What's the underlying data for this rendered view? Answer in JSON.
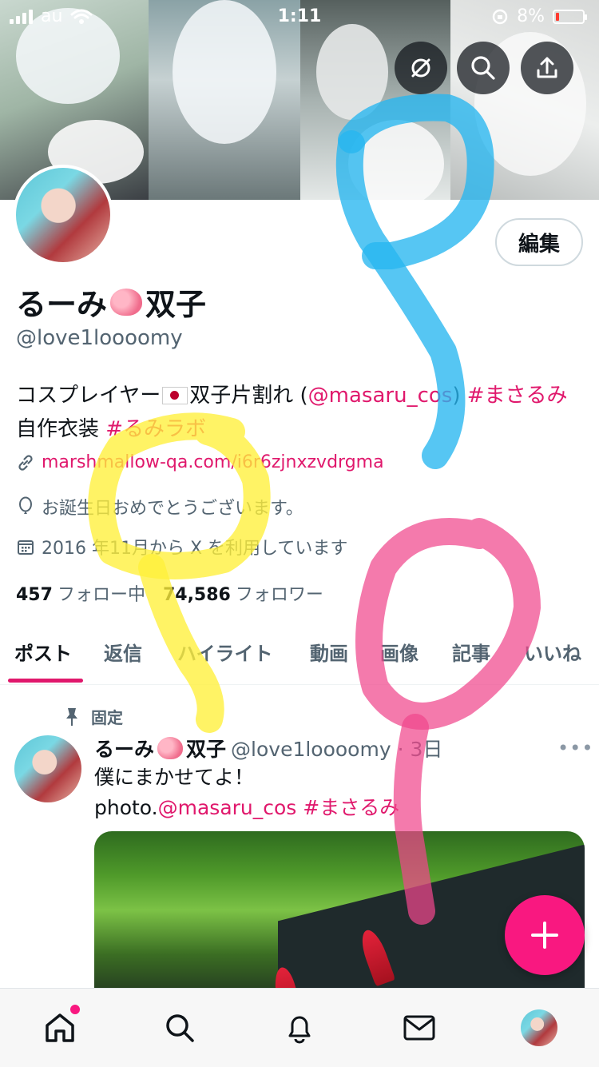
{
  "status_bar": {
    "carrier": "au",
    "time": "1:11",
    "battery": "8%"
  },
  "profile": {
    "edit_label": "編集",
    "name": "るーみ",
    "name_suffix": "双子",
    "handle": "@love1loooomy",
    "bio_line1_a": "コスプレイヤー",
    "bio_line1_b": "双子片割れ (",
    "bio_mention": "@masaru_cos",
    "bio_line1_c": ") ",
    "bio_hashtag1": "#まさるみ",
    "bio_line2_a": "自作衣装 ",
    "bio_hashtag2": "#るみラボ",
    "link": "marshmallow-qa.com/i6r6zjnxzvdrgma",
    "birthday": "お誕生日おめでとうございます。",
    "joined": "2016 年11月から X を利用しています",
    "following_count": "457",
    "following_label": "フォロー中",
    "followers_count": "74,586",
    "followers_label": "フォロワー"
  },
  "tabs": [
    "ポスト",
    "返信",
    "ハイライト",
    "動画",
    "画像",
    "記事",
    "いいね"
  ],
  "post": {
    "pinned_label": "固定",
    "author": "るーみ",
    "author_suffix": "双子",
    "handle_time": "@love1loooomy · 3日",
    "more": "•••",
    "line1": "僕にまかせてよ！",
    "line2_a": "photo.",
    "mention": "@masaru_cos",
    "hashtag": " #まさるみ"
  },
  "colors": {
    "accent": "#f91880",
    "link": "#e0186c",
    "muted": "#536471"
  },
  "icons": [
    "signal-icon",
    "wifi-icon",
    "lock-rotation-icon",
    "battery-icon",
    "hide-icon",
    "search-icon",
    "share-icon",
    "link-icon",
    "balloon-icon",
    "calendar-icon",
    "pin-icon",
    "compose-icon",
    "home-icon",
    "notifications-icon",
    "messages-icon"
  ]
}
